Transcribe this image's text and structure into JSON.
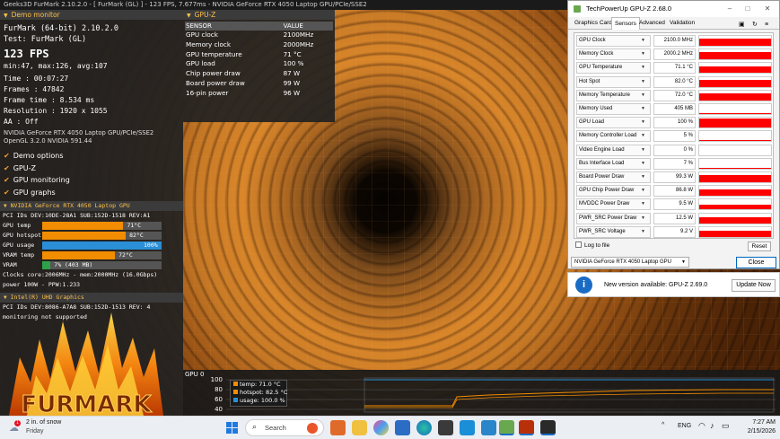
{
  "titlebar": "Geeks3D FurMark 2.10.2.0 - [ FurMark (GL) ] - 123 FPS, 7.677ms - NVIDIA GeForce RTX 4050 Laptop GPU/PCIe/SSE2",
  "demo": {
    "header": "Demo monitor",
    "app": "FurMark (64-bit) 2.10.2.0",
    "test": "Test: FurMark (GL)",
    "fps": "123 FPS",
    "minmax": "min:47, max:126, avg:107",
    "time": "Time       : 00:07:27",
    "frames": "Frames     : 47842",
    "frametime": "Frame time : 8.534 ms",
    "resolution": "Resolution : 1920 x 1055",
    "aa": "AA         : Off",
    "gpu_line": "NVIDIA GeForce RTX 4050 Laptop GPU/PCIe/SSE2",
    "gl_line": "OpenGL 3.2.0 NVIDIA 591.44",
    "options": [
      "Demo options",
      "GPU-Z",
      "GPU monitoring",
      "GPU graphs"
    ]
  },
  "nvidia": {
    "header": "NVIDIA GeForce RTX 4050 Laptop GPU",
    "pci": "PCI IDs     DEV:10DE-28A1 SUB:152D-1518 REV:A1",
    "bars": [
      {
        "label": "GPU temp",
        "value": "71°C",
        "pct": 0.68,
        "color": "#f28c00"
      },
      {
        "label": "GPU hotspot",
        "value": "82°C",
        "pct": 0.7,
        "color": "#f28c00"
      },
      {
        "label": "GPU usage",
        "value": "100%",
        "pct": 1.0,
        "color": "#2a8fd6"
      },
      {
        "label": "VRAM temp",
        "value": "72°C",
        "pct": 0.61,
        "color": "#f28c00"
      },
      {
        "label": "VRAM",
        "value": "7% (403 MB)",
        "pct": 0.07,
        "color": "#2fa04a"
      }
    ],
    "clocks": "Clocks      core:2006MHz - mem:2000MHz (16.0Gbps)",
    "power": "power       100W - PPW:1.233"
  },
  "intel": {
    "header": "Intel(R) UHD Graphics",
    "pci": "PCI IDs     DEV:8086-A7A8 SUB:152D-1513 REV: 4",
    "monitoring": "monitoring not supported"
  },
  "logo_text": "FURMARK",
  "gpuz_overlay": {
    "header": "GPU-Z",
    "col1": "SENSOR",
    "col2": "VALUE",
    "rows": [
      {
        "sensor": "GPU clock",
        "value": "2100MHz"
      },
      {
        "sensor": "Memory clock",
        "value": "2000MHz"
      },
      {
        "sensor": "GPU temperature",
        "value": "71 °C"
      },
      {
        "sensor": "GPU load",
        "value": "100 %"
      },
      {
        "sensor": "Chip power draw",
        "value": "87 W"
      },
      {
        "sensor": "Board power draw",
        "value": "99 W"
      },
      {
        "sensor": "16-pin power",
        "value": "96 W"
      }
    ]
  },
  "graph": {
    "label": "GPU 0",
    "yticks": [
      "100",
      "80",
      "60",
      "40"
    ],
    "legend": [
      "temp: 71.0 °C",
      "hotspot: 82.5 °C",
      "usage: 100.0 %"
    ],
    "colors": [
      "#f28c00",
      "#f28c00",
      "#2a8fd6"
    ]
  },
  "gpuz": {
    "title": "TechPowerUp GPU-Z 2.68.0",
    "tabs": [
      "Graphics Card",
      "Sensors",
      "Advanced",
      "Validation"
    ],
    "sensors": [
      {
        "name": "GPU Clock",
        "value": "2100.0 MHz",
        "level": 0.75
      },
      {
        "name": "Memory Clock",
        "value": "2000.2 MHz",
        "level": 0.75
      },
      {
        "name": "GPU Temperature",
        "value": "71.1 °C",
        "level": 0.7
      },
      {
        "name": "Hot Spot",
        "value": "82.0 °C",
        "level": 0.7
      },
      {
        "name": "Memory Temperature",
        "value": "72.0 °C",
        "level": 0.7
      },
      {
        "name": "Memory Used",
        "value": "405 MB",
        "level": 0.1
      },
      {
        "name": "GPU Load",
        "value": "100 %",
        "level": 0.9
      },
      {
        "name": "Memory Controller Load",
        "value": "5 %",
        "level": 0.05
      },
      {
        "name": "Video Engine Load",
        "value": "0 %",
        "level": 0.0
      },
      {
        "name": "Bus Interface Load",
        "value": "7 %",
        "level": 0.08
      },
      {
        "name": "Board Power Draw",
        "value": "99.3 W",
        "level": 0.75
      },
      {
        "name": "GPU Chip Power Draw",
        "value": "86.8 W",
        "level": 0.7
      },
      {
        "name": "MVDDC Power Draw",
        "value": "9.5 W",
        "level": 0.5
      },
      {
        "name": "PWR_SRC Power Draw",
        "value": "12.5 W",
        "level": 0.6
      },
      {
        "name": "PWR_SRC Voltage",
        "value": "9.2 V",
        "level": 0.6
      }
    ],
    "log": "Log to file",
    "reset": "Reset",
    "gpu_select": "NVIDIA GeForce RTX 4050 Laptop GPU",
    "close": "Close"
  },
  "update": {
    "text": "New version available: GPU-Z 2.69.0",
    "button": "Update Now"
  },
  "taskbar": {
    "weather_title": "2 in. of snow",
    "weather_sub": "Friday",
    "badge": "1",
    "search": "Search",
    "lang": "ENG",
    "time": "7:27 AM",
    "date": "2/15/2026"
  }
}
